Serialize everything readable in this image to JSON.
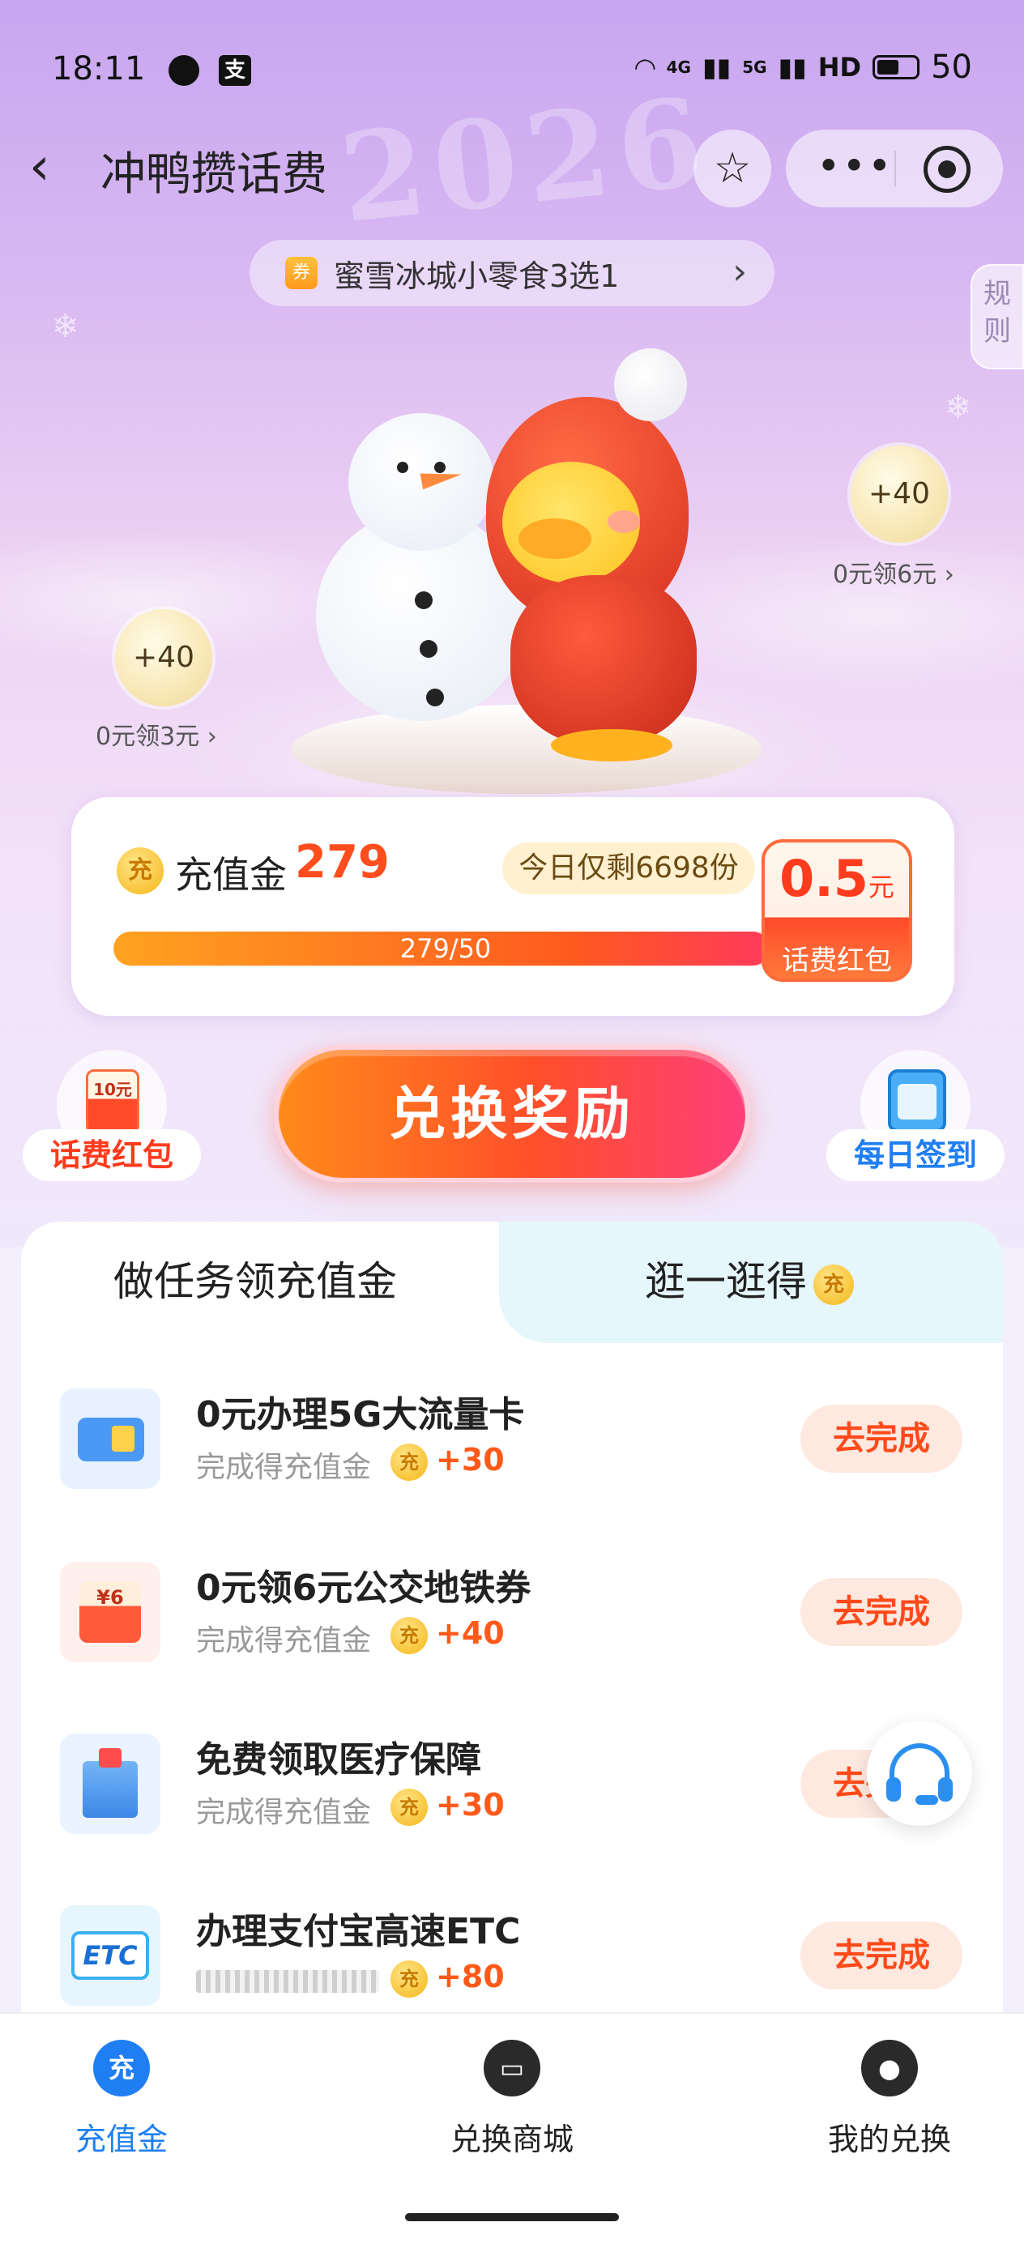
{
  "status_bar": {
    "time": "18:11",
    "app_icon_glyph": "支",
    "network_4g": "4G",
    "network_5g": "5G",
    "hd_label": "HD",
    "battery": "50"
  },
  "header": {
    "title": "冲鸭攒话费",
    "back_glyph": "‹",
    "fav_icon": "☆",
    "more_glyph": "•••"
  },
  "promo": {
    "badge": "券",
    "text": "蜜雪冰城小零食3选1",
    "chevron": "›"
  },
  "rules_tab": "规则",
  "bubbles": [
    {
      "value": "+40",
      "caption": "0元领6元 ›"
    },
    {
      "value": "+40",
      "caption": "0元领3元 ›"
    }
  ],
  "recharge_card": {
    "coin_glyph": "充",
    "label": "充值金",
    "amount": "279",
    "remaining": "今日仅剩6698份",
    "progress_text": "279/50",
    "progress_fraction": 0.9,
    "redpacket_value": "0.5",
    "redpacket_unit": "元",
    "redpacket_caption": "话费红包"
  },
  "actions": {
    "left_label": "话费红包",
    "left_env_text": "10元",
    "main_cta": "兑换奖励",
    "right_label": "每日签到"
  },
  "tabs": {
    "active": "做任务领充值金",
    "other": "逛一逛得",
    "coin_glyph": "充"
  },
  "tasks": [
    {
      "name": "0元办理5G大流量卡",
      "sub": "完成得充值金",
      "reward": "+30",
      "button": "去完成",
      "icon": "sim-card-icon"
    },
    {
      "name": "0元领6元公交地铁券",
      "sub": "完成得充值金",
      "reward": "+40",
      "button": "去完成",
      "icon": "red-packet-icon"
    },
    {
      "name": "免费领取医疗保障",
      "sub": "完成得充值金",
      "reward": "+30",
      "button": "去完成",
      "icon": "hospital-icon"
    },
    {
      "name": "办理支付宝高速ETC",
      "sub": "",
      "reward": "+80",
      "button": "去完成",
      "icon": "etc-icon",
      "icon_text": "ETC"
    }
  ],
  "task_coin_glyph": "充",
  "bottom_nav": [
    {
      "label": "充值金",
      "glyph": "充",
      "active": true
    },
    {
      "label": "兑换商城",
      "glyph": "▭",
      "active": false
    },
    {
      "label": "我的兑换",
      "glyph": "●",
      "active": false
    }
  ],
  "colors": {
    "accent_orange": "#ff4d1d",
    "active_blue": "#1f7ff2",
    "reward_orange": "#ff5a1a"
  }
}
